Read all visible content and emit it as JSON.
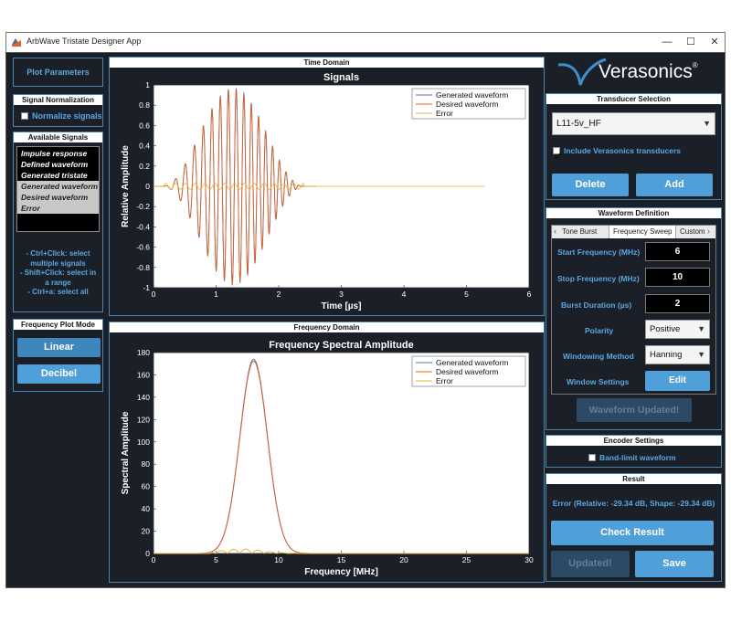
{
  "window": {
    "title": "ArbWave Tristate Designer App",
    "minimize": "—",
    "maximize": "☐",
    "close": "✕"
  },
  "colors": {
    "background": "#1b1f28",
    "accent": "#4f9fd8",
    "border": "#4a85b0",
    "series_generated": "#4a78b5",
    "series_desired": "#d9622b",
    "series_error": "#e6b531"
  },
  "left": {
    "plot_params_button": "Plot Parameters",
    "signal_norm": {
      "header": "Signal Normalization",
      "checkbox_label": "Normalize signals",
      "checked": false
    },
    "available": {
      "header": "Available Signals",
      "items": [
        "Impulse response",
        "Defined waveform",
        "Generated tristate",
        "Generated waveform",
        "Desired waveform",
        "Error"
      ],
      "selected": [
        false,
        false,
        false,
        true,
        true,
        true
      ]
    },
    "hints": [
      "- Ctrl+Click: select",
      "multiple signals",
      "- Shift+Click: select in",
      "a range",
      "- Ctrl+a: select all"
    ],
    "freq_mode": {
      "header": "Frequency Plot Mode",
      "linear": "Linear",
      "decibel": "Decibel"
    }
  },
  "time_panel": {
    "header": "Time Domain"
  },
  "freq_panel": {
    "header": "Frequency Domain"
  },
  "brand": {
    "logo_text": "Verasonics",
    "mark": "®"
  },
  "transducer": {
    "header": "Transducer Selection",
    "selected": "L11-5v_HF",
    "include_label": "Include Verasonics transducers",
    "include_checked": true,
    "delete": "Delete",
    "add": "Add"
  },
  "waveform_def": {
    "header": "Waveform Definition",
    "tabs": [
      "Tone Burst",
      "Frequency Sweep",
      "Custom"
    ],
    "active_tab": 1,
    "start_freq_label": "Start Frequency (MHz)",
    "start_freq": "6",
    "stop_freq_label": "Stop Frequency (MHz)",
    "stop_freq": "10",
    "burst_label": "Burst Duration (µs)",
    "burst": "2",
    "polarity_label": "Polarity",
    "polarity": "Positive",
    "window_label": "Windowing Method",
    "window": "Hanning",
    "settings_label": "Window Settings",
    "edit": "Edit",
    "updated_button": "Waveform Updated!"
  },
  "encoder": {
    "header": "Encoder Settings",
    "bandlimit_label": "Band-limit waveform",
    "bandlimit_checked": false
  },
  "result": {
    "header": "Result",
    "text": "Error (Relative: -29.34 dB, Shape: -29.34 dB)",
    "check": "Check Result",
    "updated": "Updated!",
    "save": "Save"
  },
  "chart_data": [
    {
      "type": "line",
      "title": "Signals",
      "xlabel": "Time [µs]",
      "ylabel": "Relative Amplitude",
      "xlim": [
        0,
        6
      ],
      "ylim": [
        -1,
        1
      ],
      "xticks": [
        0,
        1,
        2,
        3,
        4,
        5,
        6
      ],
      "yticks": [
        -1,
        -0.8,
        -0.6,
        -0.4,
        -0.2,
        0,
        0.2,
        0.4,
        0.6,
        0.8,
        1
      ],
      "legend": "top-right",
      "grid": false,
      "series": [
        {
          "name": "Generated waveform",
          "envelope_peak": 0.97,
          "center_us": 1.3,
          "width_us": 2.3,
          "start_us": 0.15,
          "end_us": 2.4,
          "freq_mhz_start": 6,
          "freq_mhz_end": 10
        },
        {
          "name": "Desired waveform",
          "envelope_peak": 0.97,
          "center_us": 1.3,
          "width_us": 2.3,
          "start_us": 0.15,
          "end_us": 2.4,
          "freq_mhz_start": 6,
          "freq_mhz_end": 10
        },
        {
          "name": "Error",
          "peak": 0.03,
          "x_range": [
            0,
            5.3
          ]
        }
      ]
    },
    {
      "type": "line",
      "title": "Frequency Spectral Amplitude",
      "xlabel": "Frequency [MHz]",
      "ylabel": "Spectral Amplitude",
      "xlim": [
        0,
        30
      ],
      "ylim": [
        0,
        180
      ],
      "xticks": [
        0,
        5,
        10,
        15,
        20,
        25,
        30
      ],
      "yticks": [
        0,
        20,
        40,
        60,
        80,
        100,
        120,
        140,
        160,
        180
      ],
      "legend": "top-right",
      "grid": false,
      "series": [
        {
          "name": "Generated waveform",
          "peak_mhz": 8,
          "peak_value": 174,
          "sigma_mhz": 1.1
        },
        {
          "name": "Desired waveform",
          "peak_mhz": 8,
          "peak_value": 174,
          "sigma_mhz": 1.1
        },
        {
          "name": "Error",
          "peak_mhz": 7,
          "peak_value": 4
        }
      ]
    }
  ]
}
